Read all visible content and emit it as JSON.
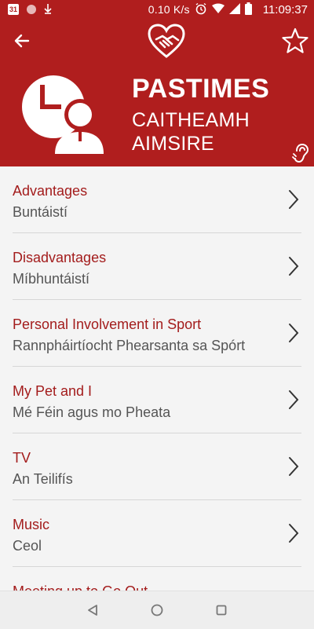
{
  "status_bar": {
    "calendar_day": "31",
    "net_speed": "0.10 K/s",
    "time": "11:09:37",
    "icons": [
      "calendar-icon",
      "circle-notification-icon",
      "download-icon",
      "alarm-icon",
      "wifi-icon",
      "signal-icon",
      "battery-icon"
    ]
  },
  "header": {
    "title": "PASTIMES",
    "subtitle_line1": "CAITHEAMH",
    "subtitle_line2": "AIMSIRE",
    "icons": [
      "back-arrow-icon",
      "handshake-heart-logo",
      "star-icon",
      "clock-person-icon",
      "ear-icon"
    ]
  },
  "items": [
    {
      "title": "Advantages",
      "subtitle": "Buntáistí"
    },
    {
      "title": "Disadvantages",
      "subtitle": "Míbhuntáistí"
    },
    {
      "title": "Personal Involvement in Sport",
      "subtitle": "Rannpháirtíocht Phearsanta sa Spórt"
    },
    {
      "title": "My Pet and I",
      "subtitle": "Mé Féin agus mo Pheata"
    },
    {
      "title": "TV",
      "subtitle": "An Teilifís"
    },
    {
      "title": "Music",
      "subtitle": "Ceol"
    },
    {
      "title": "Meeting up to Go Out",
      "subtitle": ""
    }
  ],
  "nav": {
    "icons": [
      "back-triangle-icon",
      "home-circle-icon",
      "recents-square-icon"
    ]
  },
  "colors": {
    "primary": "#b01e1e",
    "item_title": "#a31c1c",
    "item_subtitle": "#555555",
    "background": "#f4f4f4"
  }
}
